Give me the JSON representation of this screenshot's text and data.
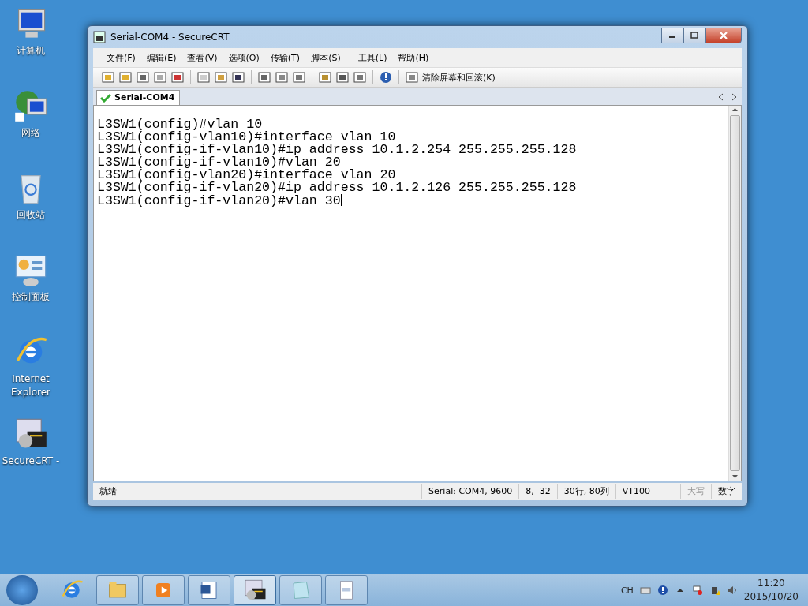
{
  "desktop_icons": [
    {
      "kind": "computer",
      "label": "计算机"
    },
    {
      "kind": "network",
      "label": "网络"
    },
    {
      "kind": "recycle",
      "label": "回收站"
    },
    {
      "kind": "control",
      "label": "控制面板"
    },
    {
      "kind": "ie",
      "label": "Internet Explorer"
    },
    {
      "kind": "securecrt",
      "label": "SecureCRT -"
    }
  ],
  "window": {
    "title": "Serial-COM4 - SecureCRT",
    "menu": [
      "文件(F)",
      "编辑(E)",
      "查看(V)",
      "选项(O)",
      "传输(T)",
      "脚本(S)",
      "工具(L)",
      "帮助(H)"
    ],
    "toolbar": {
      "clear_button": "清除屏幕和回滚(K)"
    },
    "tabs": [
      {
        "label": "Serial-COM4",
        "selected": true
      }
    ],
    "terminal": {
      "lines": [
        "L3SW1(config)#vlan 10",
        "L3SW1(config-vlan10)#interface vlan 10",
        "L3SW1(config-if-vlan10)#ip address 10.1.2.254 255.255.255.128",
        "L3SW1(config-if-vlan10)#vlan 20",
        "L3SW1(config-vlan20)#interface vlan 20",
        "L3SW1(config-if-vlan20)#ip address 10.1.2.126 255.255.255.128",
        "L3SW1(config-if-vlan20)#vlan 30"
      ]
    },
    "status_bar": {
      "status": "就绪",
      "connection": "Serial: COM4, 9600",
      "cursor": "8,  32",
      "size": "30行, 80列",
      "emulation": "VT100",
      "indicators": [
        {
          "label": "大写",
          "disabled": true
        },
        {
          "label": "数字",
          "disabled": false
        }
      ]
    }
  },
  "taskbar": {
    "apps": [
      {
        "kind": "ie",
        "open": false,
        "selected": false
      },
      {
        "kind": "explorer",
        "open": true,
        "selected": false
      },
      {
        "kind": "media",
        "open": true,
        "selected": false
      },
      {
        "kind": "word",
        "open": true,
        "selected": false
      },
      {
        "kind": "securecrt",
        "open": true,
        "selected": true
      },
      {
        "kind": "notepad",
        "open": true,
        "selected": false
      },
      {
        "kind": "document",
        "open": true,
        "selected": false
      }
    ],
    "language": "CH",
    "time": "11:20",
    "date": "2015/10/20"
  }
}
